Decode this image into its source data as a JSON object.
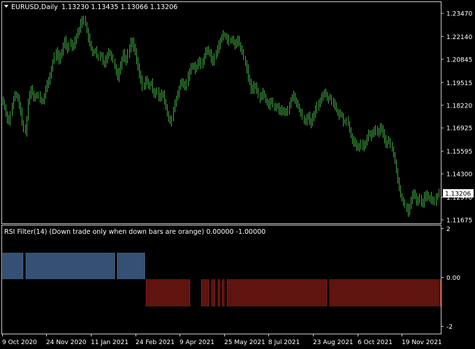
{
  "main_chart": {
    "symbol": "EURUSD,Daily",
    "ohlc": "1.13230 1.13435 1.13066 1.13206",
    "price_labels": [
      "1.23470",
      "1.22140",
      "1.20845",
      "1.19515",
      "1.18220",
      "1.16925",
      "1.15595",
      "1.14300",
      "1.12970",
      "1.11675"
    ],
    "current_price": "1.13206",
    "candle_color": "#3fa93f"
  },
  "indicator": {
    "title": "RSI Filter(14)  (Down trade only when down bars are orange) 0.00000 -1.00000",
    "scale_labels": [
      "2",
      "0.00",
      "-2"
    ],
    "up_color": "#6aa1e6",
    "down_color": "#c0281e"
  },
  "date_labels": [
    "9 Oct 2020",
    "24 Nov 2020",
    "11 Jan 2021",
    "24 Feb 2021",
    "9 Apr 2021",
    "25 May 2021",
    "8 Jul 2021",
    "23 Aug 2021",
    "6 Oct 2021",
    "19 Nov 2021"
  ],
  "chart_data": {
    "type": "line",
    "x": [
      "9 Oct 2020",
      "24 Nov 2020",
      "11 Jan 2021",
      "24 Feb 2021",
      "9 Apr 2021",
      "25 May 2021",
      "8 Jul 2021",
      "23 Aug 2021",
      "6 Oct 2021",
      "19 Nov 2021"
    ],
    "series": [
      {
        "values": [
          1.18,
          1.195,
          1.227,
          1.216,
          1.175,
          1.223,
          1.178,
          1.172,
          1.164,
          1.132
        ]
      }
    ],
    "path": [
      [
        0,
        1.182
      ],
      [
        5,
        1.186
      ],
      [
        10,
        1.178
      ],
      [
        14,
        1.172
      ],
      [
        18,
        1.18
      ],
      [
        22,
        1.188
      ],
      [
        25,
        1.188
      ],
      [
        30,
        1.182
      ],
      [
        34,
        1.17
      ],
      [
        38,
        1.167
      ],
      [
        42,
        1.185
      ],
      [
        46,
        1.192
      ],
      [
        50,
        1.187
      ],
      [
        56,
        1.188
      ],
      [
        62,
        1.183
      ],
      [
        66,
        1.19
      ],
      [
        70,
        1.195
      ],
      [
        74,
        1.2
      ],
      [
        78,
        1.208
      ],
      [
        82,
        1.213
      ],
      [
        86,
        1.208
      ],
      [
        90,
        1.212
      ],
      [
        94,
        1.22
      ],
      [
        98,
        1.214
      ],
      [
        102,
        1.219
      ],
      [
        106,
        1.215
      ],
      [
        110,
        1.221
      ],
      [
        114,
        1.224
      ],
      [
        118,
        1.23
      ],
      [
        122,
        1.232
      ],
      [
        126,
        1.224
      ],
      [
        130,
        1.217
      ],
      [
        134,
        1.212
      ],
      [
        138,
        1.214
      ],
      [
        142,
        1.208
      ],
      [
        146,
        1.212
      ],
      [
        150,
        1.205
      ],
      [
        154,
        1.21
      ],
      [
        158,
        1.213
      ],
      [
        162,
        1.21
      ],
      [
        166,
        1.204
      ],
      [
        170,
        1.198
      ],
      [
        174,
        1.205
      ],
      [
        178,
        1.212
      ],
      [
        182,
        1.207
      ],
      [
        186,
        1.214
      ],
      [
        190,
        1.22
      ],
      [
        194,
        1.214
      ],
      [
        198,
        1.206
      ],
      [
        202,
        1.199
      ],
      [
        206,
        1.192
      ],
      [
        210,
        1.197
      ],
      [
        214,
        1.193
      ],
      [
        218,
        1.195
      ],
      [
        222,
        1.188
      ],
      [
        226,
        1.192
      ],
      [
        230,
        1.185
      ],
      [
        234,
        1.19
      ],
      [
        238,
        1.183
      ],
      [
        242,
        1.176
      ],
      [
        246,
        1.172
      ],
      [
        250,
        1.18
      ],
      [
        254,
        1.186
      ],
      [
        258,
        1.192
      ],
      [
        262,
        1.196
      ],
      [
        266,
        1.192
      ],
      [
        270,
        1.198
      ],
      [
        274,
        1.203
      ],
      [
        278,
        1.206
      ],
      [
        282,
        1.202
      ],
      [
        286,
        1.208
      ],
      [
        290,
        1.205
      ],
      [
        294,
        1.211
      ],
      [
        298,
        1.214
      ],
      [
        302,
        1.212
      ],
      [
        306,
        1.206
      ],
      [
        310,
        1.212
      ],
      [
        314,
        1.216
      ],
      [
        318,
        1.22
      ],
      [
        322,
        1.223
      ],
      [
        326,
        1.221
      ],
      [
        330,
        1.218
      ],
      [
        334,
        1.22
      ],
      [
        338,
        1.216
      ],
      [
        342,
        1.22
      ],
      [
        346,
        1.215
      ],
      [
        350,
        1.21
      ],
      [
        354,
        1.204
      ],
      [
        358,
        1.196
      ],
      [
        362,
        1.19
      ],
      [
        366,
        1.195
      ],
      [
        370,
        1.189
      ],
      [
        374,
        1.186
      ],
      [
        378,
        1.19
      ],
      [
        382,
        1.185
      ],
      [
        386,
        1.182
      ],
      [
        390,
        1.186
      ],
      [
        394,
        1.18
      ],
      [
        398,
        1.183
      ],
      [
        402,
        1.178
      ],
      [
        406,
        1.18
      ],
      [
        410,
        1.177
      ],
      [
        414,
        1.18
      ],
      [
        418,
        1.186
      ],
      [
        422,
        1.188
      ],
      [
        426,
        1.183
      ],
      [
        430,
        1.18
      ],
      [
        434,
        1.176
      ],
      [
        438,
        1.172
      ],
      [
        442,
        1.178
      ],
      [
        446,
        1.17
      ],
      [
        450,
        1.176
      ],
      [
        454,
        1.18
      ],
      [
        458,
        1.184
      ],
      [
        462,
        1.187
      ],
      [
        466,
        1.19
      ],
      [
        470,
        1.186
      ],
      [
        474,
        1.187
      ],
      [
        478,
        1.184
      ],
      [
        482,
        1.18
      ],
      [
        486,
        1.176
      ],
      [
        490,
        1.178
      ],
      [
        494,
        1.172
      ],
      [
        498,
        1.174
      ],
      [
        502,
        1.168
      ],
      [
        506,
        1.162
      ],
      [
        510,
        1.16
      ],
      [
        514,
        1.157
      ],
      [
        518,
        1.161
      ],
      [
        522,
        1.158
      ],
      [
        526,
        1.162
      ],
      [
        530,
        1.167
      ],
      [
        534,
        1.164
      ],
      [
        538,
        1.169
      ],
      [
        542,
        1.166
      ],
      [
        546,
        1.17
      ],
      [
        550,
        1.166
      ],
      [
        554,
        1.16
      ],
      [
        558,
        1.162
      ],
      [
        562,
        1.158
      ],
      [
        566,
        1.152
      ],
      [
        570,
        1.142
      ],
      [
        574,
        1.132
      ],
      [
        578,
        1.128
      ],
      [
        582,
        1.125
      ],
      [
        586,
        1.121
      ],
      [
        590,
        1.128
      ],
      [
        594,
        1.133
      ],
      [
        598,
        1.127
      ],
      [
        602,
        1.13
      ],
      [
        606,
        1.125
      ],
      [
        610,
        1.132
      ],
      [
        614,
        1.129
      ],
      [
        618,
        1.13
      ],
      [
        622,
        1.126
      ],
      [
        626,
        1.13
      ],
      [
        630,
        1.1321
      ]
    ],
    "ylim": [
      1.11675,
      1.2347
    ],
    "indicator_segments": [
      {
        "from": 4,
        "to": 33,
        "value": 1
      },
      {
        "from": 37,
        "to": 163,
        "value": 1
      },
      {
        "from": 168,
        "to": 206,
        "value": 1
      },
      {
        "from": 209,
        "to": 271,
        "value": -1
      },
      {
        "from": 288,
        "to": 299,
        "value": -1
      },
      {
        "from": 303,
        "to": 308,
        "value": -1
      },
      {
        "from": 312,
        "to": 315,
        "value": -1
      },
      {
        "from": 318,
        "to": 321,
        "value": -1
      },
      {
        "from": 325,
        "to": 467,
        "value": -1
      },
      {
        "from": 472,
        "to": 630,
        "value": -1
      }
    ]
  }
}
